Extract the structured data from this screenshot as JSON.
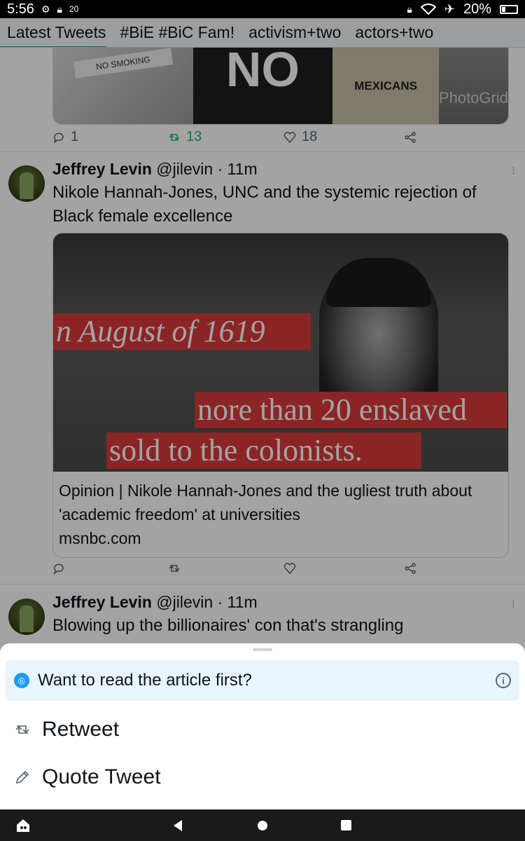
{
  "status_bar": {
    "time": "5:56",
    "small_badge": "20",
    "battery": "20%"
  },
  "tabs": [
    {
      "label": "Latest Tweets"
    },
    {
      "label": "#BiE #BiC Fam!"
    },
    {
      "label": "activism+two"
    },
    {
      "label": "actors+two"
    }
  ],
  "prev_tweet": {
    "image_texts": {
      "sign": "NO SMOKING",
      "big": "NO",
      "mexicans": "MEXICANS",
      "watermark": "PhotoGrid"
    },
    "replies": "1",
    "retweets": "13",
    "likes": "18"
  },
  "tweet1": {
    "name": "Jeffrey Levin",
    "handle": "@jilevin",
    "time": "· 11m",
    "text": "Nikole Hannah-Jones, UNC and the systemic rejection of Black female excellence",
    "card": {
      "band1": "n August of 1619",
      "band2": "nore than 20 enslaved",
      "band3": " sold to the  colonists.",
      "title": "Opinion | Nikole Hannah-Jones and the ugliest truth about 'academic freedom' at universities",
      "domain": "msnbc.com"
    }
  },
  "tweet2": {
    "name": "Jeffrey Levin",
    "handle": "@jilevin",
    "time": "· 11m",
    "text": "Blowing up the billionaires' con that's strangling"
  },
  "sheet": {
    "banner": "Want to read the article first?",
    "retweet": "Retweet",
    "quote": "Quote Tweet"
  }
}
